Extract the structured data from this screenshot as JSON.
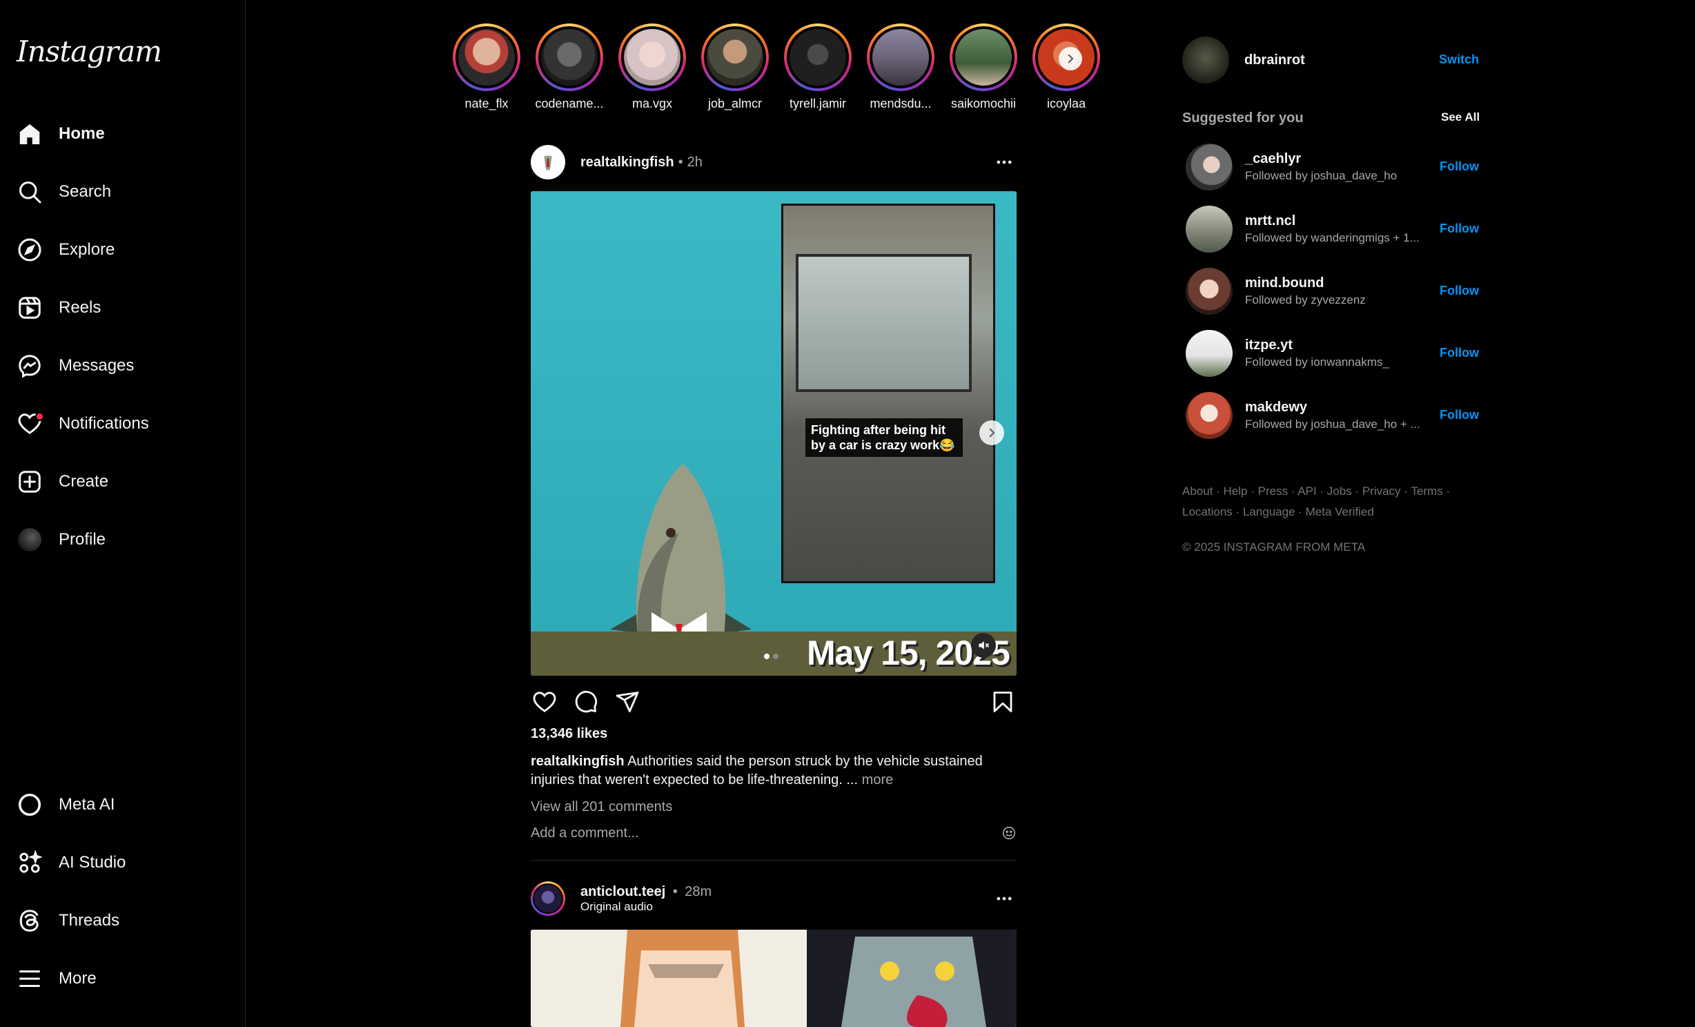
{
  "app": {
    "logo": "Instagram"
  },
  "sidebar": {
    "items": [
      {
        "label": "Home",
        "icon": "home-icon"
      },
      {
        "label": "Search",
        "icon": "search-icon"
      },
      {
        "label": "Explore",
        "icon": "compass-icon"
      },
      {
        "label": "Reels",
        "icon": "reels-icon"
      },
      {
        "label": "Messages",
        "icon": "messenger-icon"
      },
      {
        "label": "Notifications",
        "icon": "heart-icon"
      },
      {
        "label": "Create",
        "icon": "plus-square-icon"
      },
      {
        "label": "Profile",
        "icon": "avatar"
      },
      {
        "label": "Meta AI",
        "icon": "meta-ai-icon"
      },
      {
        "label": "AI Studio",
        "icon": "ai-studio-icon"
      },
      {
        "label": "Threads",
        "icon": "threads-icon"
      },
      {
        "label": "More",
        "icon": "menu-icon"
      }
    ]
  },
  "stories": [
    {
      "name": "nate_flx",
      "color": "#b5403a"
    },
    {
      "name": "codename...",
      "color": "#3a3a3a"
    },
    {
      "name": "ma.vgx",
      "color": "#d7c3c3"
    },
    {
      "name": "job_almcr",
      "color": "#4b4a3e"
    },
    {
      "name": "tyrell.jamir",
      "color": "#1f1f1f"
    },
    {
      "name": "mendsdu...",
      "color": "#6d6478"
    },
    {
      "name": "saikomochii",
      "color": "#3e5b3a"
    },
    {
      "name": "icoylaa",
      "color": "#c93a1c"
    }
  ],
  "post": {
    "username": "realtalkingfish",
    "time": "2h",
    "overlay_text": "Fighting after being hit by a car is crazy work😂",
    "date_text": "May 15, 2025",
    "likes": "13,346 likes",
    "caption_user": "realtalkingfish",
    "caption_text": "Authorities said the person struck by the vehicle sustained injuries that weren't expected to be life-threatening. ...",
    "more_label": "more",
    "view_comments": "View all 201 comments",
    "comment_placeholder": "Add a comment..."
  },
  "post2": {
    "username": "anticlout.teej",
    "time": "28m",
    "audio": "Original audio"
  },
  "me": {
    "username": "dbrainrot",
    "switch_label": "Switch"
  },
  "suggestions": {
    "title": "Suggested for you",
    "see_all": "See All",
    "follow_label": "Follow",
    "items": [
      {
        "name": "_caehlyr",
        "sub": "Followed by joshua_dave_ho",
        "color": "#6b6b6b"
      },
      {
        "name": "mrtt.ncl",
        "sub": "Followed by wanderingmigs + 1...",
        "color": "#8c8c80"
      },
      {
        "name": "mind.bound",
        "sub": "Followed by zyvezzenz",
        "color": "#b08a7c"
      },
      {
        "name": "itzpe.yt",
        "sub": "Followed by ionwannakms_",
        "color": "#e4e4e4"
      },
      {
        "name": "makdewy",
        "sub": "Followed by joshua_dave_ho + ...",
        "color": "#c9503a"
      }
    ]
  },
  "footer": {
    "links_line1": [
      "About",
      "Help",
      "Press",
      "API",
      "Jobs",
      "Privacy",
      "Terms"
    ],
    "links_line2": [
      "Locations",
      "Language",
      "Meta Verified"
    ],
    "copyright": "© 2025 INSTAGRAM FROM META"
  }
}
